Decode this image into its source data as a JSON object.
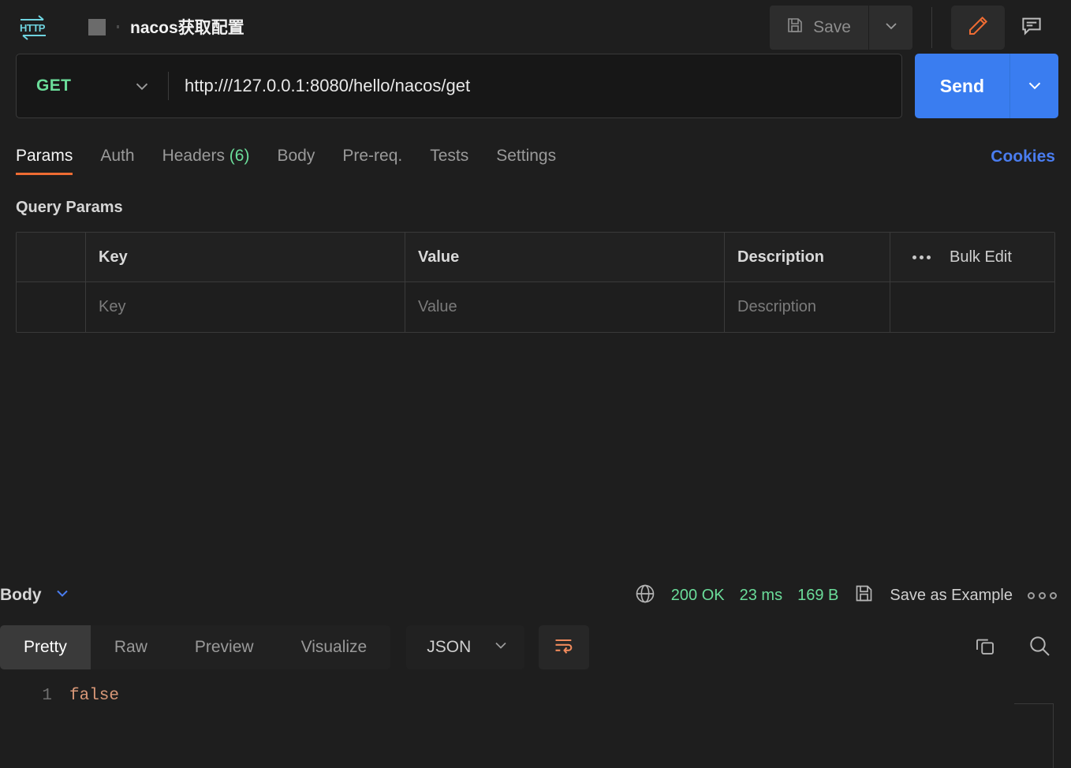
{
  "header": {
    "protocol_icon_label": "HTTP",
    "request_title": "nacos获取配置",
    "save_label": "Save"
  },
  "request": {
    "method": "GET",
    "url": "http:///127.0.0.1:8080/hello/nacos/get",
    "send_label": "Send"
  },
  "request_tabs": [
    {
      "label": "Params",
      "active": true
    },
    {
      "label": "Auth",
      "active": false
    },
    {
      "label": "Headers",
      "count": "(6)",
      "active": false
    },
    {
      "label": "Body",
      "active": false
    },
    {
      "label": "Pre-req.",
      "active": false
    },
    {
      "label": "Tests",
      "active": false
    },
    {
      "label": "Settings",
      "active": false
    }
  ],
  "cookies_link": "Cookies",
  "query_params": {
    "section_title": "Query Params",
    "columns": [
      "Key",
      "Value",
      "Description"
    ],
    "bulk_edit_label": "Bulk Edit",
    "rows": [
      {
        "key": "Key",
        "value": "Value",
        "description": "Description"
      }
    ]
  },
  "response": {
    "body_toggle_label": "Body",
    "status": "200 OK",
    "time": "23 ms",
    "size": "169 B",
    "save_as_example_label": "Save as Example",
    "view_tabs": [
      {
        "label": "Pretty",
        "active": true
      },
      {
        "label": "Raw",
        "active": false
      },
      {
        "label": "Preview",
        "active": false
      },
      {
        "label": "Visualize",
        "active": false
      }
    ],
    "format": "JSON",
    "code_lines": [
      {
        "number": "1",
        "text": "false"
      }
    ]
  },
  "colors": {
    "accent_orange": "#ef6c33",
    "send_blue": "#3a7df0",
    "method_green": "#6bdd9a",
    "status_green": "#6bdd9a",
    "link_blue": "#4a7df0",
    "http_icon_cyan": "#6fd4e0",
    "code_value": "#d99878"
  }
}
